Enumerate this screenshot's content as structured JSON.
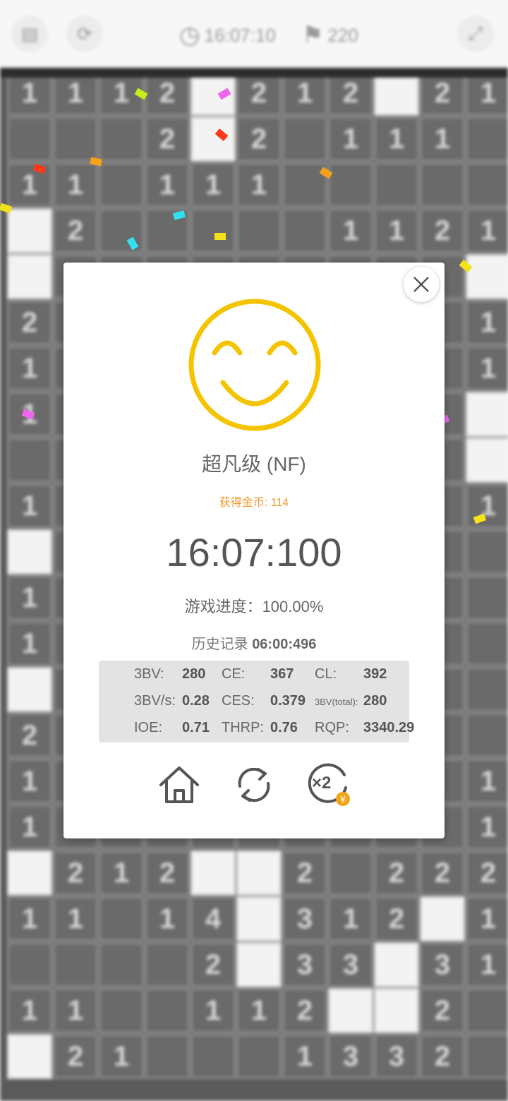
{
  "topbar": {
    "left_icons": [
      "document-icon",
      "refresh-icon"
    ],
    "timer_icon": "clock-icon",
    "timer": "16:07:10",
    "flag_icon": "flag-icon",
    "flags": "220",
    "right_icon": "expand-icon"
  },
  "board": {
    "columns": 11,
    "rows": [
      [
        "1",
        "1",
        "1",
        "2",
        "",
        "2",
        "1",
        "2",
        "",
        "2",
        "1"
      ],
      [
        "#",
        "#",
        "#",
        "2",
        "",
        "2",
        "#",
        "1",
        "1",
        "1",
        "#"
      ],
      [
        "1",
        "1",
        "#",
        "1",
        "1",
        "1",
        "#",
        "#",
        "#",
        "#",
        "#"
      ],
      [
        "",
        "2",
        "#",
        "#",
        "#",
        "#",
        "#",
        "1",
        "1",
        "2",
        "1"
      ],
      [
        "",
        "#",
        "#",
        "#",
        "#",
        "#",
        "#",
        "#",
        "#",
        "#",
        ""
      ],
      [
        "2",
        "#",
        "#",
        "#",
        "#",
        "#",
        "#",
        "#",
        "#",
        "#",
        "1"
      ],
      [
        "1",
        "#",
        "#",
        "#",
        "#",
        "#",
        "#",
        "#",
        "#",
        "#",
        "1"
      ],
      [
        "1",
        "#",
        "#",
        "#",
        "#",
        "#",
        "#",
        "#",
        "#",
        "#",
        ""
      ],
      [
        "#",
        "#",
        "#",
        "#",
        "#",
        "#",
        "#",
        "#",
        "#",
        "#",
        ""
      ],
      [
        "1",
        "#",
        "#",
        "#",
        "#",
        "#",
        "#",
        "#",
        "#",
        "#",
        "1"
      ],
      [
        "",
        "#",
        "#",
        "#",
        "#",
        "#",
        "#",
        "#",
        "#",
        "#",
        "#"
      ],
      [
        "1",
        "#",
        "#",
        "#",
        "#",
        "#",
        "#",
        "#",
        "#",
        "#",
        "#"
      ],
      [
        "1",
        "#",
        "#",
        "#",
        "#",
        "#",
        "#",
        "#",
        "#",
        "#",
        "#"
      ],
      [
        "",
        "#",
        "#",
        "#",
        "#",
        "#",
        "#",
        "#",
        "#",
        "#",
        "#"
      ],
      [
        "2",
        "#",
        "#",
        "#",
        "#",
        "#",
        "#",
        "#",
        "#",
        "#",
        "#"
      ],
      [
        "1",
        "#",
        "#",
        "#",
        "#",
        "#",
        "#",
        "#",
        "#",
        "#",
        "1"
      ],
      [
        "1",
        "#",
        "#",
        "#",
        "#",
        "#",
        "#",
        "#",
        "#",
        "#",
        "1"
      ],
      [
        "",
        "2",
        "1",
        "2",
        "",
        "",
        "2",
        "#",
        "2",
        "2",
        "2"
      ],
      [
        "1",
        "1",
        "#",
        "1",
        "4",
        "",
        "3",
        "1",
        "2",
        "",
        "1"
      ],
      [
        "#",
        "#",
        "#",
        "#",
        "2",
        "",
        "3",
        "3",
        "",
        "3",
        "1"
      ],
      [
        "1",
        "1",
        "#",
        "#",
        "1",
        "1",
        "2",
        "",
        "",
        "2",
        "#"
      ],
      [
        "",
        "2",
        "1",
        "#",
        "#",
        "#",
        "1",
        "3",
        "3",
        "2",
        "#"
      ]
    ]
  },
  "modal": {
    "close_icon": "close-icon",
    "face_icon": "smiley-face-icon",
    "level": "超凡级 (NF)",
    "coins": "获得金币: 114",
    "time": "16:07:100",
    "progress": "游戏进度：100.00%",
    "history_label": "历史记录",
    "history_value": "06:00:496",
    "stats": {
      "r1": [
        {
          "label": "3BV:",
          "value": "280"
        },
        {
          "label": "CE:",
          "value": "367"
        },
        {
          "label": "CL:",
          "value": "392"
        }
      ],
      "r2": [
        {
          "label": "3BV/s:",
          "value": "0.28"
        },
        {
          "label": "CES:",
          "value": "0.379"
        },
        {
          "label": "3BV(total):",
          "value": "280"
        }
      ],
      "r3": [
        {
          "label": "IOE:",
          "value": "0.71"
        },
        {
          "label": "THRP:",
          "value": "0.76"
        },
        {
          "label": "RQP:",
          "value": "3340.29"
        }
      ]
    },
    "actions": {
      "home_icon": "home-icon",
      "replay_icon": "replay-icon",
      "double_coins_label": "×2",
      "double_coins_icon": "double-coins-icon"
    }
  },
  "colors": {
    "smiley": "#f5c400",
    "coins_text": "#ef9a2a",
    "coin_badge": "#f0a51a"
  }
}
